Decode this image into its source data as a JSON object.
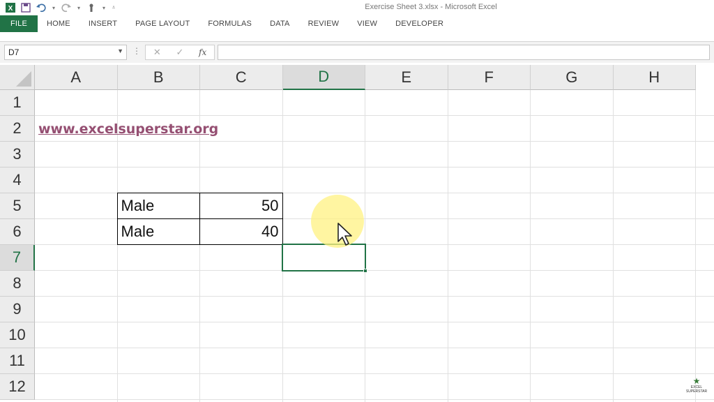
{
  "window": {
    "title": "Exercise Sheet 3.xlsx - Microsoft Excel"
  },
  "quick_access": {
    "icons": [
      "excel-logo-icon",
      "save-icon",
      "undo-icon",
      "redo-icon",
      "touch-mode-icon",
      "customize-qat-icon"
    ]
  },
  "ribbon": {
    "tabs": [
      "FILE",
      "HOME",
      "INSERT",
      "PAGE LAYOUT",
      "FORMULAS",
      "DATA",
      "REVIEW",
      "VIEW",
      "DEVELOPER"
    ],
    "accent_color": "#217346"
  },
  "formula_bar": {
    "name_box": "D7",
    "cancel_glyph": "✕",
    "enter_glyph": "✓",
    "fx_glyph": "fx",
    "formula": ""
  },
  "sheet": {
    "columns": [
      "A",
      "B",
      "C",
      "D",
      "E",
      "F",
      "G",
      "H"
    ],
    "rows": [
      "1",
      "2",
      "3",
      "4",
      "5",
      "6",
      "7",
      "8",
      "9",
      "10",
      "11",
      "12"
    ],
    "active_cell": "D7",
    "cells": {
      "A2": "www.excelsuperstar.org",
      "B5": "Male",
      "C5": "50",
      "B6": "Male",
      "C6": "40"
    },
    "link_color": "#954f72"
  },
  "watermark": {
    "text": "EXCEL SUPERSTAR"
  }
}
